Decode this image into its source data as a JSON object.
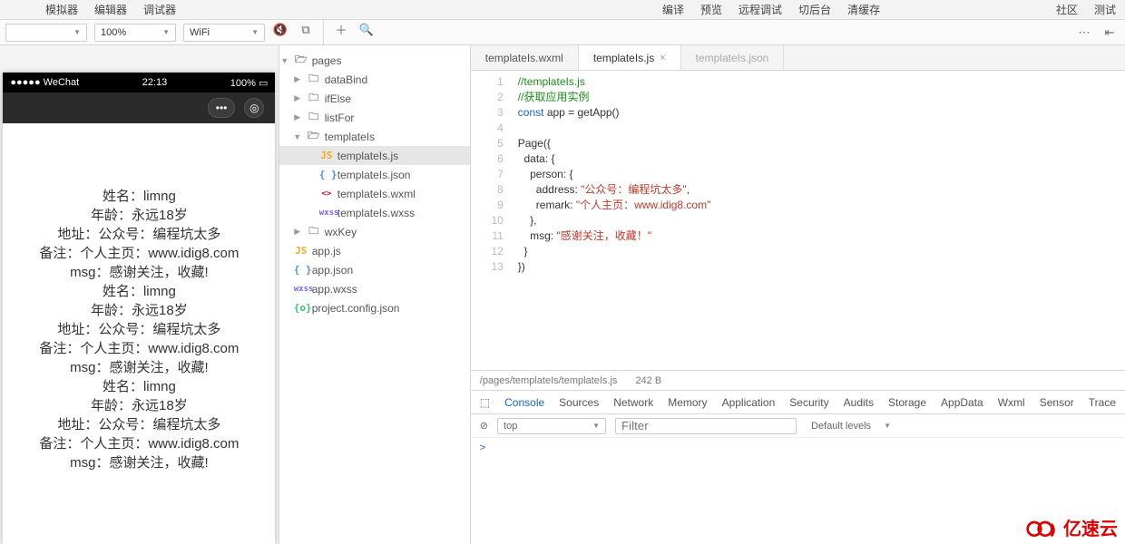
{
  "menus": {
    "left": [
      "模拟器",
      "编辑器",
      "调试器"
    ],
    "mid": [
      "编译",
      "预览",
      "远程调试",
      "切后台",
      "清缓存"
    ],
    "right": [
      "社区",
      "测试"
    ]
  },
  "toolbar": {
    "dropdown1": "",
    "zoom": "100%",
    "network": "WiFi"
  },
  "simulator": {
    "carrier": "●●●●● WeChat",
    "time": "22:13",
    "battery": "100%",
    "lines": [
      "姓名：limng",
      "年龄：永远18岁",
      "地址：公众号：编程坑太多",
      "备注：个人主页：www.idig8.com",
      "msg：感谢关注，收藏!",
      "姓名：limng",
      "年龄：永远18岁",
      "地址：公众号：编程坑太多",
      "备注：个人主页：www.idig8.com",
      "msg：感谢关注，收藏!",
      "姓名：limng",
      "年龄：永远18岁",
      "地址：公众号：编程坑太多",
      "备注：个人主页：www.idig8.com",
      "msg：感谢关注，收藏!"
    ]
  },
  "tree": [
    {
      "depth": 0,
      "arrow": "▼",
      "icon": "folderOpen",
      "label": "pages"
    },
    {
      "depth": 1,
      "arrow": "▶",
      "icon": "folder",
      "label": "dataBind"
    },
    {
      "depth": 1,
      "arrow": "▶",
      "icon": "folder",
      "label": "ifElse"
    },
    {
      "depth": 1,
      "arrow": "▶",
      "icon": "folder",
      "label": "listFor"
    },
    {
      "depth": 1,
      "arrow": "▼",
      "icon": "folderOpen",
      "label": "templateIs"
    },
    {
      "depth": 2,
      "arrow": "",
      "icon": "js",
      "label": "templateIs.js",
      "sel": true
    },
    {
      "depth": 2,
      "arrow": "",
      "icon": "json",
      "label": "templateIs.json"
    },
    {
      "depth": 2,
      "arrow": "",
      "icon": "wxml",
      "label": "templateIs.wxml"
    },
    {
      "depth": 2,
      "arrow": "",
      "icon": "wxss",
      "label": "templateIs.wxss"
    },
    {
      "depth": 1,
      "arrow": "▶",
      "icon": "folder",
      "label": "wxKey"
    },
    {
      "depth": 0,
      "arrow": "",
      "icon": "js",
      "label": "app.js"
    },
    {
      "depth": 0,
      "arrow": "",
      "icon": "json",
      "label": "app.json"
    },
    {
      "depth": 0,
      "arrow": "",
      "icon": "wxss",
      "label": "app.wxss"
    },
    {
      "depth": 0,
      "arrow": "",
      "icon": "proj",
      "label": "project.config.json"
    }
  ],
  "editorTabs": [
    {
      "label": "templateIs.wxml",
      "active": false,
      "dim": false
    },
    {
      "label": "templateIs.js",
      "active": true,
      "dim": false
    },
    {
      "label": "templateIs.json",
      "active": false,
      "dim": true
    }
  ],
  "code": {
    "lineCount": 13,
    "lines": [
      [
        {
          "t": "//templateIs.js",
          "c": "cmt"
        }
      ],
      [
        {
          "t": "//获取应用实例",
          "c": "cmt"
        }
      ],
      [
        {
          "t": "const ",
          "c": "kw"
        },
        {
          "t": "app = getApp()",
          "c": "fn"
        }
      ],
      [
        {
          "t": "",
          "c": ""
        }
      ],
      [
        {
          "t": "Page",
          "c": "fn"
        },
        {
          "t": "({",
          "c": "paren"
        }
      ],
      [
        {
          "t": "  data: {",
          "c": "prop"
        }
      ],
      [
        {
          "t": "    person: {",
          "c": "prop"
        }
      ],
      [
        {
          "t": "      address: ",
          "c": "prop"
        },
        {
          "t": "\"公众号：编程坑太多\"",
          "c": "str"
        },
        {
          "t": ",",
          "c": "paren"
        }
      ],
      [
        {
          "t": "      remark: ",
          "c": "prop"
        },
        {
          "t": "\"个人主页：www.idig8.com\"",
          "c": "str"
        }
      ],
      [
        {
          "t": "    },",
          "c": "paren"
        }
      ],
      [
        {
          "t": "    msg: ",
          "c": "prop"
        },
        {
          "t": "\"感谢关注，收藏！\"",
          "c": "str"
        }
      ],
      [
        {
          "t": "  }",
          "c": "paren"
        }
      ],
      [
        {
          "t": "})",
          "c": "paren"
        }
      ]
    ]
  },
  "status": {
    "path": "/pages/templateIs/templateIs.js",
    "size": "242 B"
  },
  "devtools": {
    "tabs": [
      "Console",
      "Sources",
      "Network",
      "Memory",
      "Application",
      "Security",
      "Audits",
      "Storage",
      "AppData",
      "Wxml",
      "Sensor",
      "Trace"
    ],
    "activeTab": "Console",
    "context": "top",
    "filterPlaceholder": "Filter",
    "levels": "Default levels",
    "prompt": ">"
  },
  "iconText": {
    "js": "JS",
    "json": "{ }",
    "wxml": "<>",
    "wxss": "wxss",
    "proj": "{o}",
    "folder": "🗀",
    "folderOpen": "🗁"
  },
  "brand": "亿速云"
}
